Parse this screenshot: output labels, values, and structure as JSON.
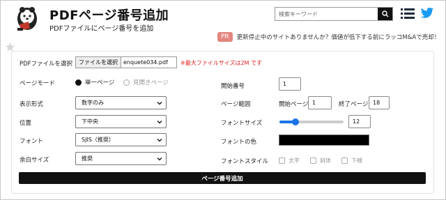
{
  "header": {
    "title": "PDFページ番号追加",
    "subtitle": "PDFファイルにページ番号を追加",
    "search_placeholder": "検索キーワード",
    "icons": [
      "mascot-logo",
      "search-icon",
      "menu-icon",
      "bird-icon",
      "star-icon"
    ]
  },
  "promo": {
    "badge": "PR",
    "text": "更新停止中のサイトありませんか？価値が低下する前にラッコM&Aで売却！"
  },
  "form": {
    "file_label": "PDFファイルを選択",
    "file_button": "ファイルを選択",
    "file_name": "enquete034.pdf",
    "max_size_note": "※最大ファイルサイズは2M です",
    "page_mode_label": "ページモード",
    "page_mode_options": [
      "単一ページ",
      "見開きページ"
    ],
    "page_mode_selected": "単一ページ",
    "display_format_label": "表示形式",
    "display_format_value": "数字のみ",
    "position_label": "位置",
    "position_value": "下中央",
    "font_label": "フォント",
    "font_value": "SJIS（推奨）",
    "margin_label": "余白サイズ",
    "margin_value": "推奨",
    "start_number_label": "開始番号",
    "start_number_value": "1",
    "page_range_label": "ページ範囲",
    "start_page_label": "開始ページ",
    "start_page_value": "1",
    "end_page_label": "終了ページ",
    "end_page_value": "18",
    "font_size_label": "フォントサイズ",
    "font_size_value": "12",
    "font_size_slider_fraction": 0.25,
    "font_color_label": "フォントの色",
    "font_color": "#000000",
    "font_style_label": "フォントスタイル",
    "font_style_options": [
      "太字",
      "斜体",
      "下線"
    ],
    "submit_label": "ページ番号追加"
  },
  "colors": {
    "accent": "#1a73e8",
    "promo_badge": "#e2857e",
    "warning": "#e02020",
    "twitter": "#1d9bf0"
  }
}
